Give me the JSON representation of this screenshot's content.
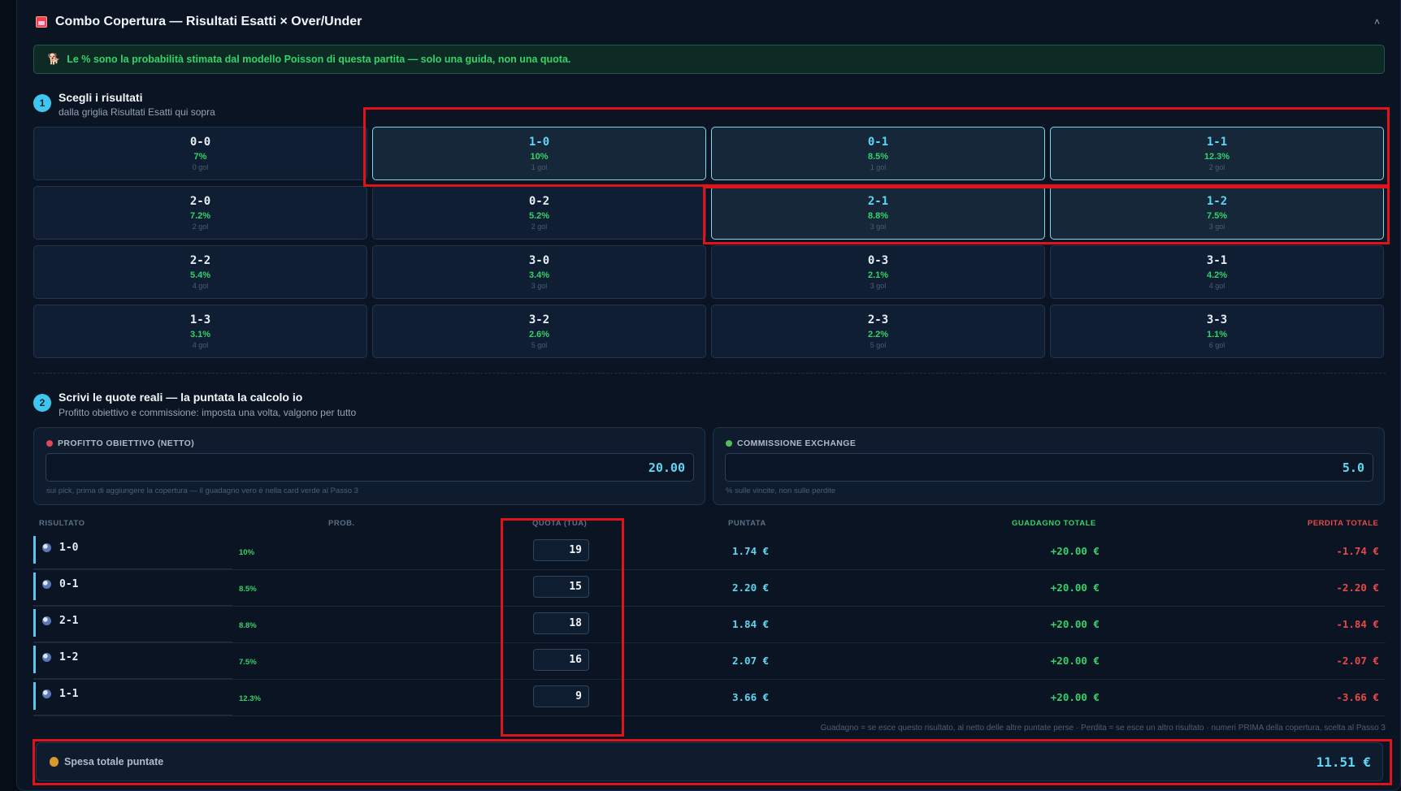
{
  "header": {
    "title": "Combo Copertura — Risultati Esatti × Over/Under",
    "collapse_icon": "˄"
  },
  "info": {
    "icon": "🐕",
    "text": "Le % sono la probabilità stimata dal modello Poisson di questa partita — solo una guida, non una quota."
  },
  "step1": {
    "num": "1",
    "title": "Scegli i risultati",
    "sub": "dalla griglia Risultati Esatti qui sopra"
  },
  "scores": [
    {
      "score": "0-0",
      "pct": "7%",
      "goals": "0 gol",
      "selected": false
    },
    {
      "score": "1-0",
      "pct": "10%",
      "goals": "1 gol",
      "selected": true
    },
    {
      "score": "0-1",
      "pct": "8.5%",
      "goals": "1 gol",
      "selected": true
    },
    {
      "score": "1-1",
      "pct": "12.3%",
      "goals": "2 gol",
      "selected": true
    },
    {
      "score": "2-0",
      "pct": "7.2%",
      "goals": "2 gol",
      "selected": false
    },
    {
      "score": "0-2",
      "pct": "5.2%",
      "goals": "2 gol",
      "selected": false
    },
    {
      "score": "2-1",
      "pct": "8.8%",
      "goals": "3 gol",
      "selected": true
    },
    {
      "score": "1-2",
      "pct": "7.5%",
      "goals": "3 gol",
      "selected": true
    },
    {
      "score": "2-2",
      "pct": "5.4%",
      "goals": "4 gol",
      "selected": false
    },
    {
      "score": "3-0",
      "pct": "3.4%",
      "goals": "3 gol",
      "selected": false
    },
    {
      "score": "0-3",
      "pct": "2.1%",
      "goals": "3 gol",
      "selected": false
    },
    {
      "score": "3-1",
      "pct": "4.2%",
      "goals": "4 gol",
      "selected": false
    },
    {
      "score": "1-3",
      "pct": "3.1%",
      "goals": "4 gol",
      "selected": false
    },
    {
      "score": "3-2",
      "pct": "2.6%",
      "goals": "5 gol",
      "selected": false
    },
    {
      "score": "2-3",
      "pct": "2.2%",
      "goals": "5 gol",
      "selected": false
    },
    {
      "score": "3-3",
      "pct": "1.1%",
      "goals": "6 gol",
      "selected": false
    }
  ],
  "step2": {
    "num": "2",
    "title": "Scrivi le quote reali — la puntata la calcolo io",
    "sub": "Profitto obiettivo e commissione: imposta una volta, valgono per tutto"
  },
  "target": {
    "label": "PROFITTO OBIETTIVO (NETTO)",
    "value": "20.00",
    "hint": "sui pick, prima di aggiungere la copertura — il guadagno vero è nella card verde al Passo 3",
    "icon_color": "#e0475a"
  },
  "commission": {
    "label": "COMMISSIONE EXCHANGE",
    "value": "5.0",
    "hint": "% sulle vincite, non sulle perdite",
    "icon_color": "#4fbf5a"
  },
  "table": {
    "headers": {
      "result": "RISULTATO",
      "prob": "PROB.",
      "odds": "QUOTA (TUA)",
      "stake": "PUNTATA",
      "gain": "GUADAGNO TOTALE",
      "loss": "PERDITA TOTALE"
    },
    "rows": [
      {
        "result": "1-0",
        "prob": "10%",
        "odds": "19",
        "stake": "1.74 €",
        "gain": "+20.00 €",
        "loss": "-1.74 €"
      },
      {
        "result": "0-1",
        "prob": "8.5%",
        "odds": "15",
        "stake": "2.20 €",
        "gain": "+20.00 €",
        "loss": "-2.20 €"
      },
      {
        "result": "2-1",
        "prob": "8.8%",
        "odds": "18",
        "stake": "1.84 €",
        "gain": "+20.00 €",
        "loss": "-1.84 €"
      },
      {
        "result": "1-2",
        "prob": "7.5%",
        "odds": "16",
        "stake": "2.07 €",
        "gain": "+20.00 €",
        "loss": "-2.07 €"
      },
      {
        "result": "1-1",
        "prob": "12.3%",
        "odds": "9",
        "stake": "3.66 €",
        "gain": "+20.00 €",
        "loss": "-3.66 €"
      }
    ],
    "footnote": "Guadagno = se esce questo risultato, al netto delle altre puntate perse · Perdita = se esce un altro risultato · numeri PRIMA della copertura, scelta al Passo 3"
  },
  "total": {
    "label": "Spesa totale puntate",
    "value": "11.51 €"
  },
  "colors": {
    "accent": "#5fd6f2",
    "positive": "#34d36a",
    "negative": "#e8484a",
    "highlight": "#e0121a"
  }
}
